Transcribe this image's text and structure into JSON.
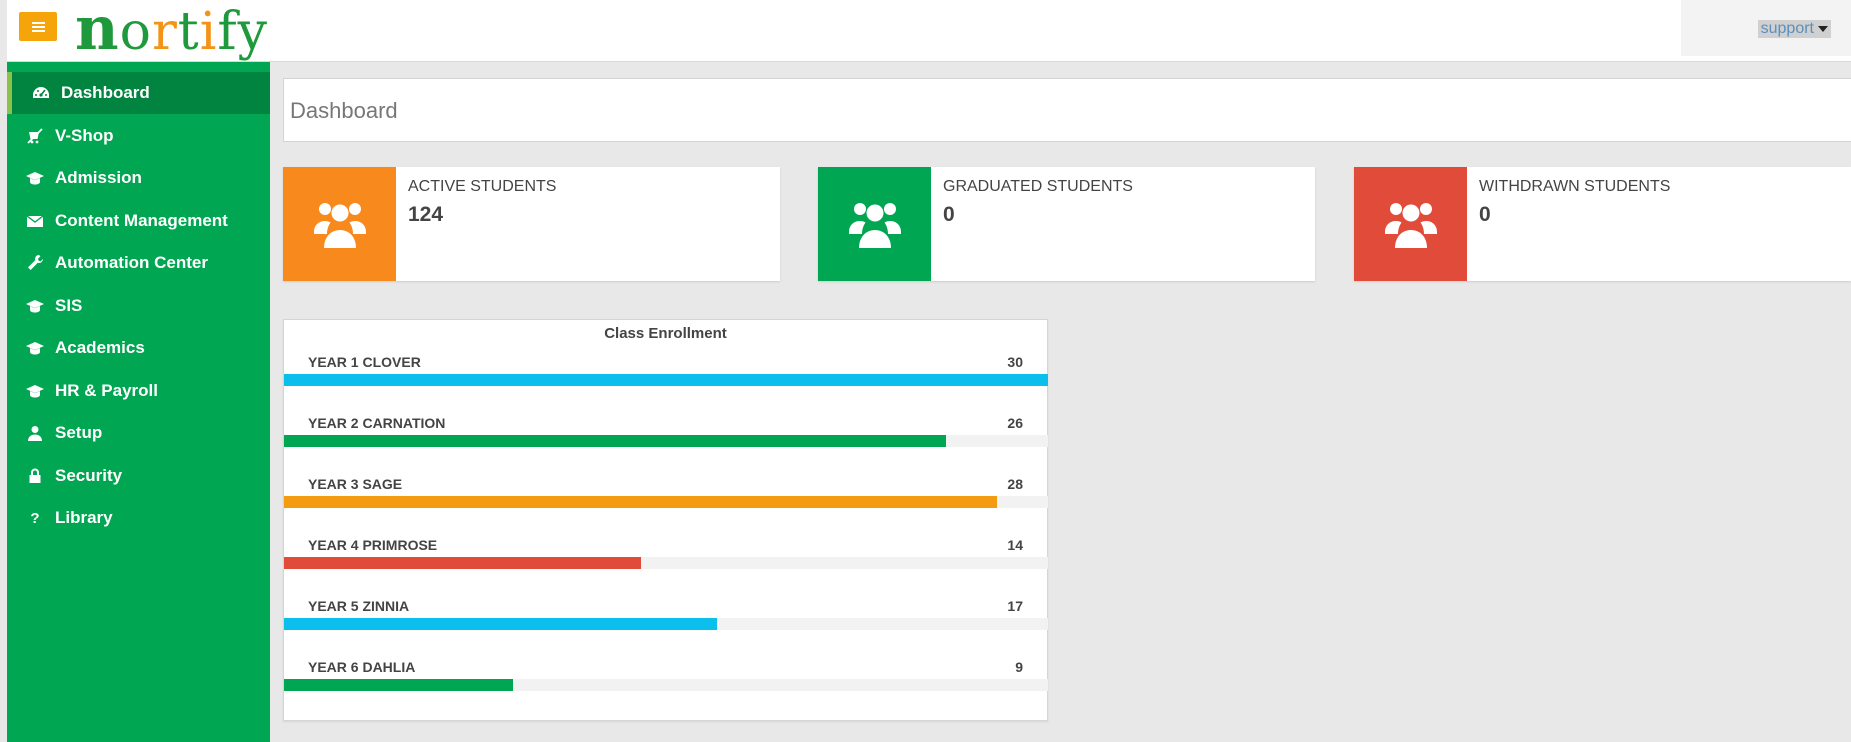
{
  "header": {
    "logo_text": "nortify",
    "user_label": "support",
    "menu_icon": "hamburger-icon"
  },
  "sidebar": {
    "items": [
      {
        "label": "Dashboard",
        "icon": "dashboard-icon",
        "active": true
      },
      {
        "label": "V-Shop",
        "icon": "shop-icon"
      },
      {
        "label": "Admission",
        "icon": "graduation-cap-icon"
      },
      {
        "label": "Content Management",
        "icon": "envelope-icon"
      },
      {
        "label": "Automation Center",
        "icon": "wrench-icon"
      },
      {
        "label": "SIS",
        "icon": "graduation-cap-icon"
      },
      {
        "label": "Academics",
        "icon": "graduation-cap-icon"
      },
      {
        "label": "HR & Payroll",
        "icon": "graduation-cap-icon"
      },
      {
        "label": "Setup",
        "icon": "user-icon"
      },
      {
        "label": "Security",
        "icon": "lock-icon"
      },
      {
        "label": "Library",
        "icon": "question-icon"
      }
    ]
  },
  "page": {
    "title": "Dashboard"
  },
  "stats": [
    {
      "label": "ACTIVE STUDENTS",
      "value": "124",
      "color": "#f7891d",
      "icon": "users-icon"
    },
    {
      "label": "GRADUATED STUDENTS",
      "value": "0",
      "color": "#00a651",
      "icon": "users-icon"
    },
    {
      "label": "WITHDRAWN STUDENTS",
      "value": "0",
      "color": "#e04b3a",
      "icon": "users-icon"
    }
  ],
  "chart_data": {
    "type": "bar",
    "title": "Class Enrollment",
    "categories": [
      "YEAR 1 CLOVER",
      "YEAR 2 CARNATION",
      "YEAR 3 SAGE",
      "YEAR 4 PRIMROSE",
      "YEAR 5 ZINNIA",
      "YEAR 6 DAHLIA"
    ],
    "values": [
      30,
      26,
      28,
      14,
      17,
      9
    ],
    "colors": [
      "#0bbfec",
      "#00a651",
      "#f39c12",
      "#e04b3a",
      "#0bbfec",
      "#00a651"
    ],
    "max": 30
  }
}
